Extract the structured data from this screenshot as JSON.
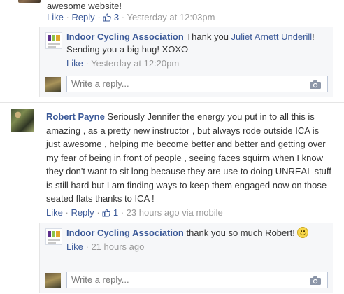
{
  "top_comment": {
    "text": "awesome website!",
    "actions": {
      "like": "Like",
      "reply": "Reply",
      "likes_count": "3",
      "time": "Yesterday at 12:03pm"
    },
    "replies": [
      {
        "author": "Indoor Cycling Association",
        "text_before": "Thank you ",
        "mention": "Juliet Arnett Underill",
        "text_after": "! Sending you a big hug! XOXO",
        "actions": {
          "like": "Like",
          "time": "Yesterday at 12:20pm"
        }
      }
    ],
    "write_reply": {
      "placeholder": "Write a reply..."
    }
  },
  "main_comment": {
    "author": "Robert Payne",
    "text": "Seriously Jennifer the energy you put in to all this is amazing , as a pretty new instructor , but always rode outside ICA is just awesome , helping me become better and better and getting over my fear of being in front of people , seeing faces squirm when I know they don't want to sit long because they are use to doing UNREAL stuff is still hard but I am finding ways to keep them engaged now on those seated flats thanks to ICA !",
    "actions": {
      "like": "Like",
      "reply": "Reply",
      "likes_count": "1",
      "time": "23 hours ago via mobile"
    },
    "replies": [
      {
        "author": "Indoor Cycling Association",
        "text": "thank you so much Robert!",
        "actions": {
          "like": "Like",
          "time": "21 hours ago"
        }
      }
    ],
    "write_reply": {
      "placeholder": "Write a reply..."
    }
  },
  "colors": {
    "link": "#3b5998",
    "meta": "#999999",
    "reply_bg": "#f6f7f9",
    "input_border": "#bdc7d8"
  },
  "icons": [
    "thumbs-up-icon",
    "camera-icon",
    "smiley-emoticon-icon"
  ]
}
